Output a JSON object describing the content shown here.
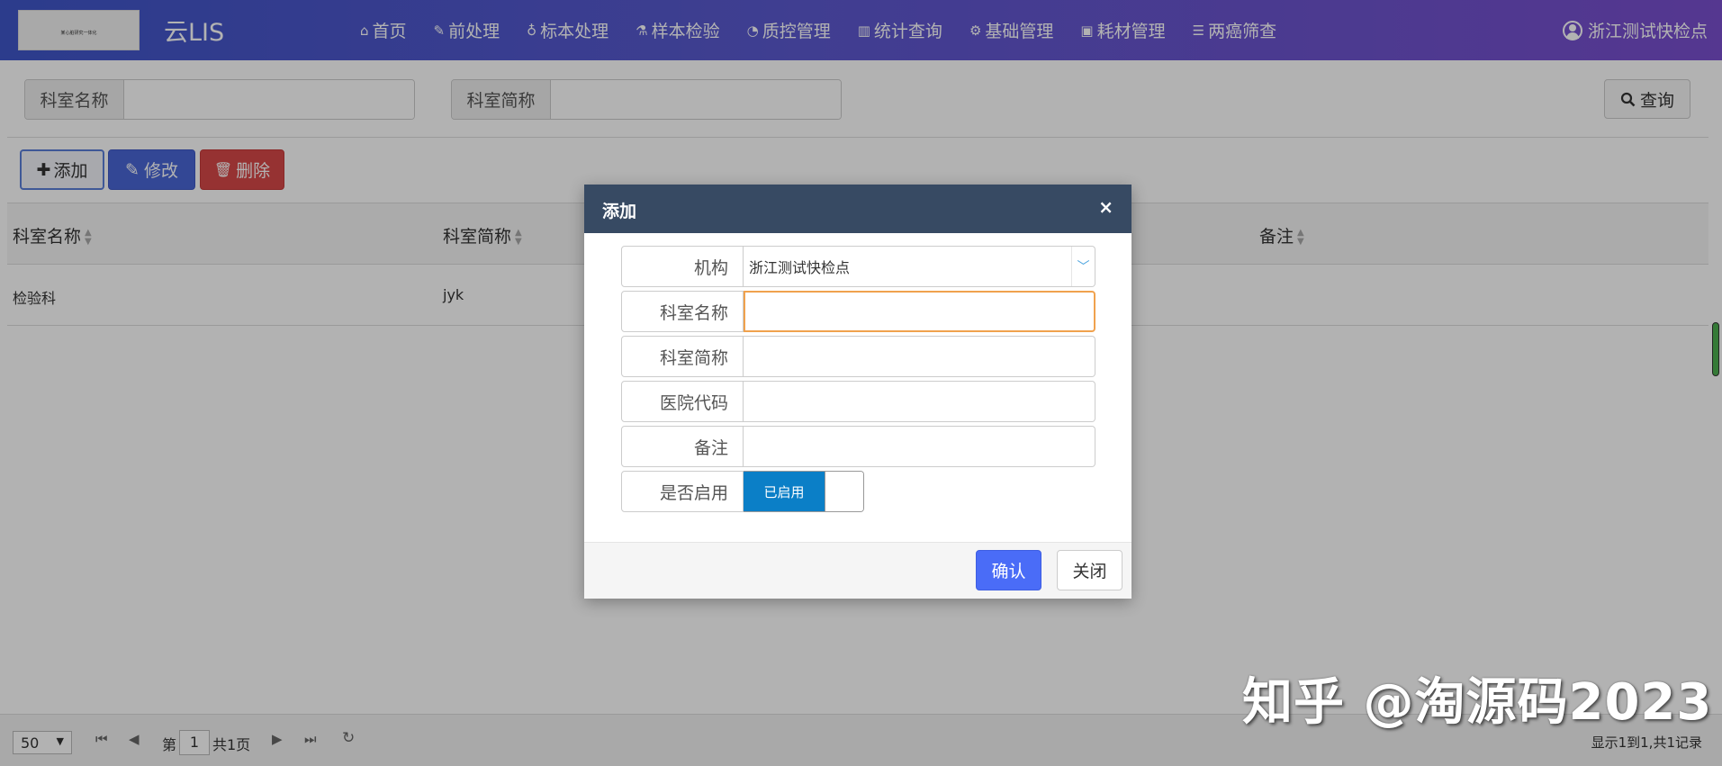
{
  "app": {
    "logo_text": "某心脏研究一体化",
    "brand": "云LIS",
    "user": "浙江测试快检点"
  },
  "nav": [
    {
      "label": "首页",
      "icon": "home-icon"
    },
    {
      "label": "前处理",
      "icon": "wrench-icon"
    },
    {
      "label": "标本处理",
      "icon": "stethoscope-icon"
    },
    {
      "label": "样本检验",
      "icon": "flask-icon"
    },
    {
      "label": "质控管理",
      "icon": "pie-chart-icon"
    },
    {
      "label": "统计查询",
      "icon": "bar-chart-icon"
    },
    {
      "label": "基础管理",
      "icon": "gear-icon"
    },
    {
      "label": "耗材管理",
      "icon": "briefcase-icon"
    },
    {
      "label": "两癌筛查",
      "icon": "list-icon"
    }
  ],
  "search": {
    "dept_name_label": "科室名称",
    "dept_name_value": "",
    "dept_abbr_label": "科室简称",
    "dept_abbr_value": "",
    "query_label": "查询"
  },
  "toolbar": {
    "add_label": "添加",
    "edit_label": "修改",
    "delete_label": "删除"
  },
  "table": {
    "columns": [
      "科室名称",
      "科室简称",
      "备注"
    ],
    "rows": [
      {
        "name": "检验科",
        "abbr": "jyk",
        "remark": ""
      }
    ]
  },
  "pager": {
    "page_size": "50",
    "page_prefix": "第",
    "page_number": "1",
    "page_suffix": "共1页",
    "info": "显示1到1,共1记录"
  },
  "modal": {
    "title": "添加",
    "close_glyph": "×",
    "fields": {
      "org_label": "机构",
      "org_value": "浙江测试快检点",
      "dept_name_label": "科室名称",
      "dept_name_value": "",
      "dept_abbr_label": "科室简称",
      "dept_abbr_value": "",
      "hospital_code_label": "医院代码",
      "hospital_code_value": "",
      "remark_label": "备注",
      "remark_value": "",
      "enabled_label": "是否启用",
      "enabled_state": "已启用"
    },
    "confirm_label": "确认",
    "close_label": "关闭"
  },
  "watermark": "知乎 @淘源码2023",
  "colors": {
    "nav_gradient_start": "#3f56c9",
    "nav_gradient_end": "#7a4fcf",
    "modal_header": "#374a63",
    "primary": "#4a6cf7",
    "edit_button": "#4a66d6",
    "delete_button": "#d74848",
    "toggle_on": "#0b7fc7",
    "focus_border": "#f0a24e"
  }
}
